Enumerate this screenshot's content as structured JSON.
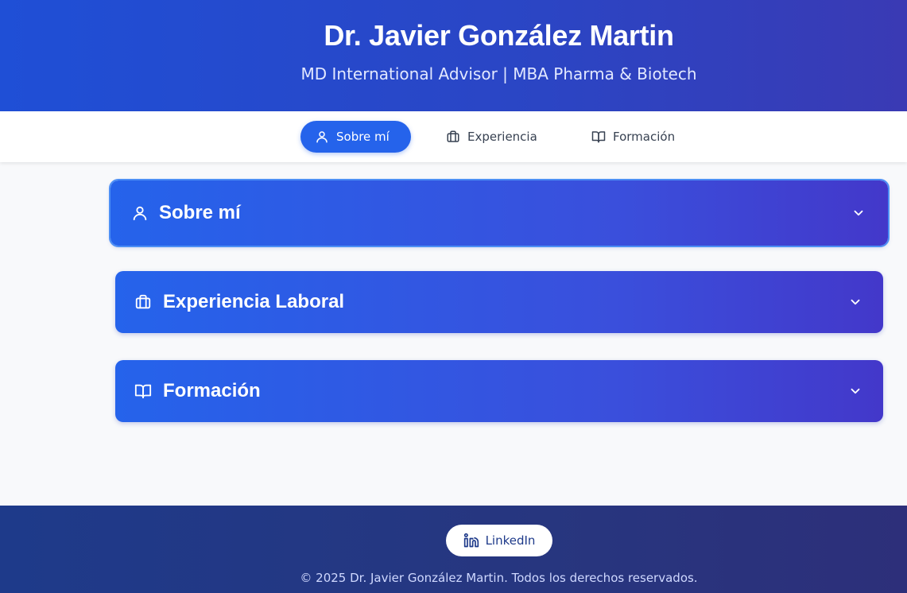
{
  "header": {
    "title": "Dr. Javier González Martin",
    "subtitle": "MD International Advisor | MBA Pharma & Biotech"
  },
  "nav": {
    "items": [
      {
        "label": "Sobre mí",
        "icon": "user-icon",
        "active": true
      },
      {
        "label": "Experiencia",
        "icon": "briefcase-icon",
        "active": false
      },
      {
        "label": "Formación",
        "icon": "book-icon",
        "active": false
      }
    ]
  },
  "sections": [
    {
      "title": "Sobre mí",
      "icon": "user-icon",
      "expanded": false
    },
    {
      "title": "Experiencia Laboral",
      "icon": "briefcase-icon",
      "expanded": false
    },
    {
      "title": "Formación",
      "icon": "book-icon",
      "expanded": false
    }
  ],
  "footer": {
    "linkedin_label": "LinkedIn",
    "copyright": "© 2025 Dr. Javier González Martin. Todos los derechos reservados."
  },
  "colors": {
    "primary": "#2563eb",
    "header_gradient_end": "#3a3ab4",
    "footer_bg": "#1e3a8a"
  }
}
